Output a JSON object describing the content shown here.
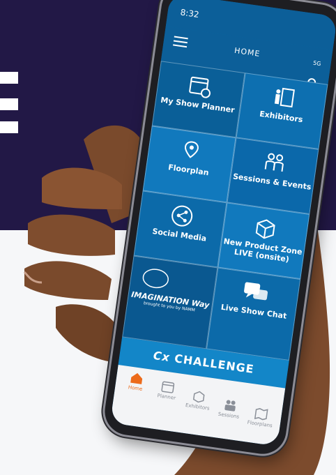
{
  "phone": {
    "status_time": "8:32",
    "status_signal": "5G",
    "screen_title": "HOME"
  },
  "tiles": [
    {
      "label": "My Show Planner",
      "icon": "calendar-icon"
    },
    {
      "label": "Exhibitors",
      "icon": "exhibitor-booth-icon"
    },
    {
      "label": "Floorplan",
      "icon": "map-pin-icon"
    },
    {
      "label": "Sessions & Events",
      "icon": "people-group-icon"
    },
    {
      "label": "Social Media",
      "icon": "share-icon"
    },
    {
      "label": "New Product Zone LIVE (onsite)",
      "icon": "box-icon"
    },
    {
      "label": "IMAGINATION Way",
      "sublabel": "brought to you by NAMM",
      "icon": "imagination-way-logo"
    },
    {
      "label": "Live Show Chat",
      "icon": "chat-bubbles-icon"
    }
  ],
  "challenge": {
    "label": "CHALLENGE",
    "icon": "cx-logo"
  },
  "tabs": [
    {
      "label": "Home",
      "icon": "house-icon",
      "active": true
    },
    {
      "label": "Planner",
      "icon": "calendar-icon"
    },
    {
      "label": "Exhibitors",
      "icon": "box-icon"
    },
    {
      "label": "Sessions",
      "icon": "people-icon"
    },
    {
      "label": "Floorplans",
      "icon": "map-icon"
    }
  ],
  "colors": {
    "background_dark": "#221846",
    "tile_blue": "#0b6aa8",
    "accent_orange": "#ec6a1a"
  }
}
